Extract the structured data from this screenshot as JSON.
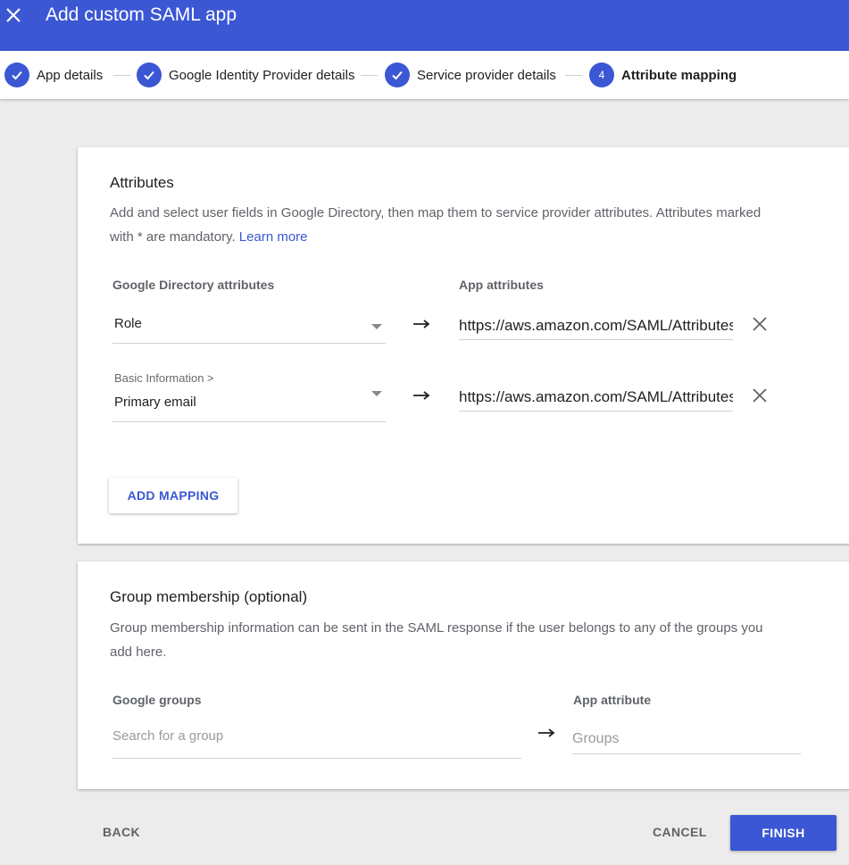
{
  "header": {
    "title": "Add custom SAML app",
    "close_icon": "close-icon"
  },
  "stepper": {
    "accent": "#3b57d4",
    "steps": [
      {
        "label": "App details",
        "state": "done"
      },
      {
        "label": "Google Identity Provider details",
        "state": "done"
      },
      {
        "label": "Service provider details",
        "state": "done"
      },
      {
        "label": "Attribute mapping",
        "number": "4",
        "state": "active"
      }
    ]
  },
  "attributes": {
    "title": "Attributes",
    "description": "Add and select user fields in Google Directory, then map them to service provider attributes. Attributes marked with * are mandatory.",
    "learn_more": "Learn more",
    "col_directory": "Google Directory attributes",
    "col_app": "App attributes",
    "mappings": [
      {
        "category": "",
        "directory_value": "Role",
        "app_value": "https://aws.amazon.com/SAML/Attributes/Role"
      },
      {
        "category": "Basic Information >",
        "directory_value": "Primary email",
        "app_value": "https://aws.amazon.com/SAML/Attributes/RoleSessionName"
      }
    ],
    "add_mapping": "ADD MAPPING"
  },
  "groups": {
    "title": "Group membership (optional)",
    "description": "Group membership information can be sent in the SAML response if the user belongs to any of the groups you add here.",
    "col_groups": "Google groups",
    "col_app": "App attribute",
    "search_placeholder": "Search for a group",
    "app_placeholder": "Groups"
  },
  "footer": {
    "back": "BACK",
    "cancel": "CANCEL",
    "finish": "FINISH"
  }
}
